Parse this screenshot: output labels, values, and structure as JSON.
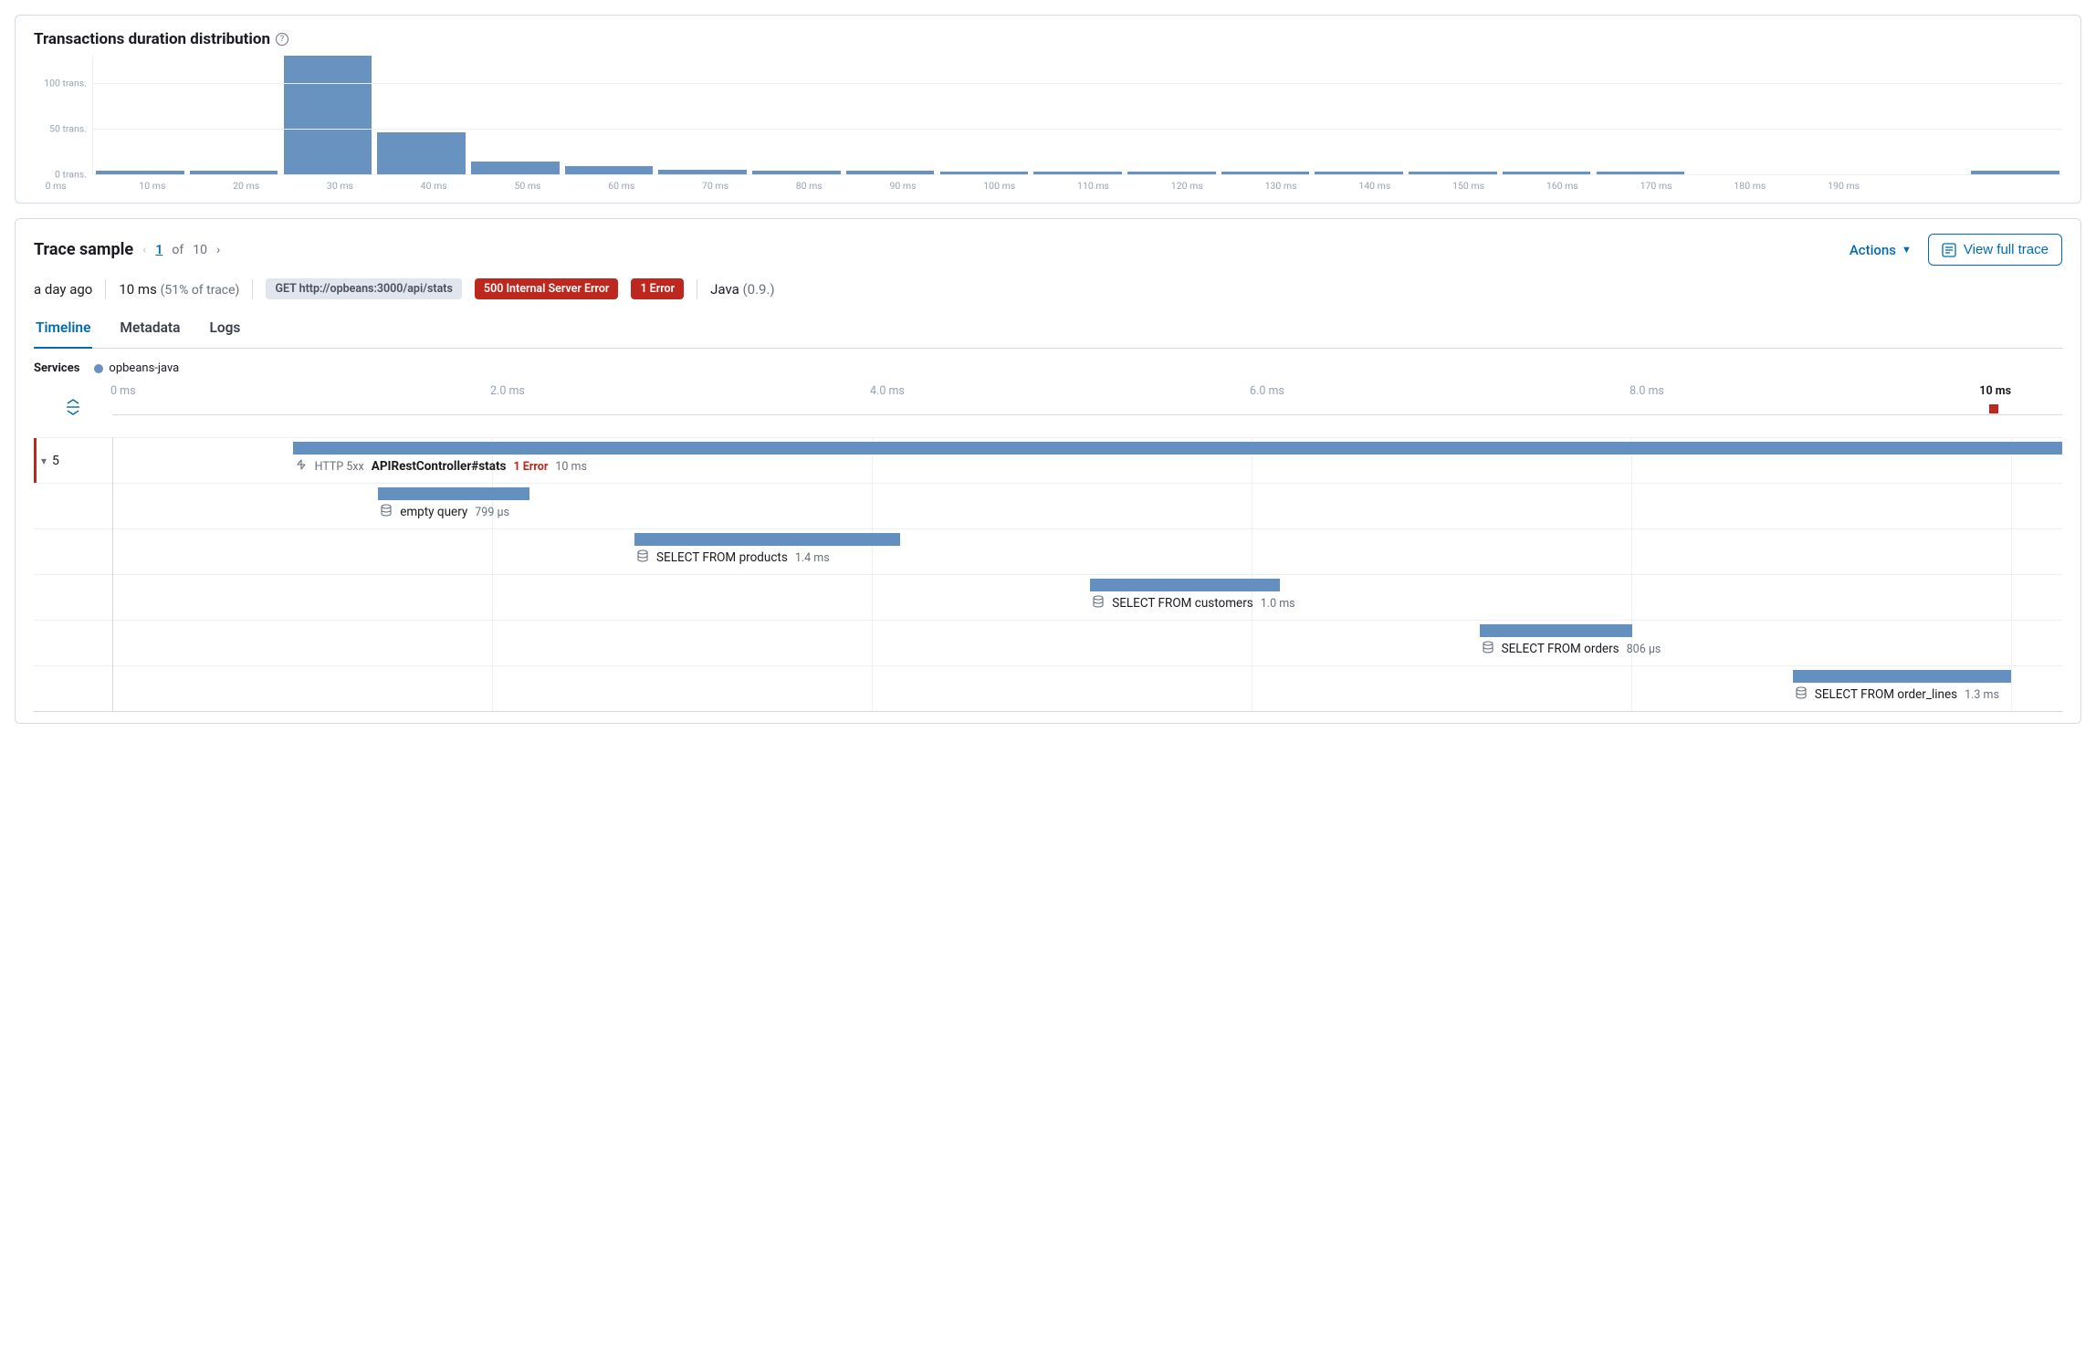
{
  "chart_data": {
    "type": "bar",
    "title": "Transactions duration distribution",
    "xlabel": "",
    "ylabel": "",
    "ylim": [
      0,
      130
    ],
    "yticks": [
      {
        "value": 0,
        "label": "0 trans."
      },
      {
        "value": 50,
        "label": "50 trans."
      },
      {
        "value": 100,
        "label": "100 trans."
      }
    ],
    "categories": [
      "0 ms",
      "10 ms",
      "20 ms",
      "30 ms",
      "40 ms",
      "50 ms",
      "60 ms",
      "70 ms",
      "80 ms",
      "90 ms",
      "100 ms",
      "110 ms",
      "120 ms",
      "130 ms",
      "140 ms",
      "150 ms",
      "160 ms",
      "170 ms",
      "180 ms",
      "190 ms"
    ],
    "values": [
      4,
      4,
      130,
      46,
      14,
      9,
      5,
      4,
      4,
      3,
      3,
      3,
      3,
      3,
      3,
      3,
      3,
      0,
      0,
      0,
      4
    ]
  },
  "trace": {
    "title": "Trace sample",
    "pager": {
      "current": "1",
      "sep": "of",
      "total": "10"
    },
    "actions_label": "Actions",
    "view_full_trace_label": "View full trace",
    "meta": {
      "age": "a day ago",
      "duration": "10 ms",
      "pct_of_trace": "(51% of trace)",
      "request_badge": "GET http://opbeans:3000/api/stats",
      "status_badge": "500 Internal Server Error",
      "error_badge": "1 Error",
      "language": "Java",
      "language_version": "(0.9.)"
    },
    "tabs": [
      "Timeline",
      "Metadata",
      "Logs"
    ],
    "active_tab": 0,
    "services_label": "Services",
    "services": [
      {
        "name": "opbeans-java",
        "color": "#6892c0"
      }
    ],
    "time_axis": {
      "max_ms": 10,
      "ticks": [
        "0 ms",
        "2.0 ms",
        "4.0 ms",
        "6.0 ms",
        "8.0 ms",
        "10 ms"
      ]
    },
    "spans": [
      {
        "id": "root",
        "kind": "http",
        "prefix": "HTTP 5xx",
        "name": "APIRestController#stats",
        "name_bold": true,
        "error_label": "1 Error",
        "duration_label": "10 ms",
        "start_ms": 0.95,
        "dur_ms": 10.0,
        "gutter_count": "5",
        "has_error_marker": true
      },
      {
        "id": "q1",
        "kind": "db",
        "name": "empty query",
        "duration_label": "799 µs",
        "start_ms": 1.4,
        "dur_ms": 0.799
      },
      {
        "id": "q2",
        "kind": "db",
        "name": "SELECT FROM products",
        "duration_label": "1.4 ms",
        "start_ms": 2.75,
        "dur_ms": 1.4
      },
      {
        "id": "q3",
        "kind": "db",
        "name": "SELECT FROM customers",
        "duration_label": "1.0 ms",
        "start_ms": 5.15,
        "dur_ms": 1.0
      },
      {
        "id": "q4",
        "kind": "db",
        "name": "SELECT FROM orders",
        "duration_label": "806 µs",
        "start_ms": 7.2,
        "dur_ms": 0.806
      },
      {
        "id": "q5",
        "kind": "db",
        "name": "SELECT FROM order_lines",
        "duration_label": "1.3 ms",
        "start_ms": 8.85,
        "dur_ms": 1.3
      }
    ]
  }
}
